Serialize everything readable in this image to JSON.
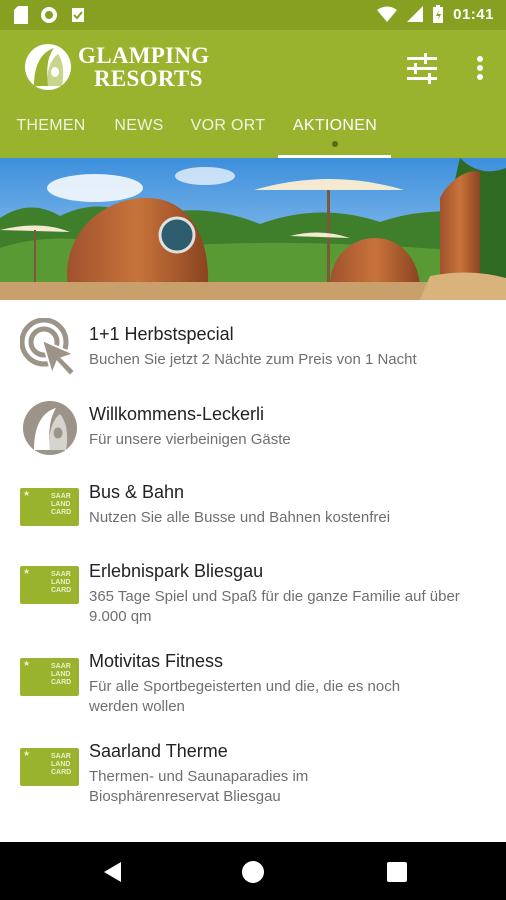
{
  "status_bar": {
    "time": "01:41",
    "left_icons": [
      "sd-card-icon",
      "circle-notification-icon",
      "download-done-icon"
    ],
    "right_icons": [
      "wifi-icon",
      "cellular-signal-icon",
      "battery-charging-icon"
    ]
  },
  "app_bar": {
    "logo_line1": "GLAMPING",
    "logo_line2": "RESORTS",
    "actions": [
      "tune-icon",
      "more-vert-icon"
    ],
    "color": "#9ab32e"
  },
  "tabs": [
    {
      "label": "THEMEN"
    },
    {
      "label": "NEWS"
    },
    {
      "label": "VOR ORT"
    },
    {
      "label": "AKTIONEN",
      "active": true
    }
  ],
  "card_text": [
    "SAAR",
    "LAND",
    "CARD"
  ],
  "items": [
    {
      "title": "1+1 Herbstspecial",
      "subtitle": "Buchen Sie jetzt 2 Nächte zum Preis von 1 Nacht",
      "icon": "click-cursor-icon"
    },
    {
      "title": "Willkommens-Leckerli",
      "subtitle": "Für unsere vierbeinigen Gäste",
      "icon": "resort-logo-icon"
    },
    {
      "title": "Bus & Bahn",
      "subtitle": "Nutzen Sie alle Busse und Bahnen kostenfrei",
      "icon": "saarland-card-icon"
    },
    {
      "title": "Erlebnispark Bliesgau",
      "subtitle": "365 Tage Spiel und Spaß für die ganze Familie auf über 9.000 qm",
      "icon": "saarland-card-icon"
    },
    {
      "title": "Motivitas Fitness",
      "subtitle": "Für alle Sportbegeisterten und die, die es noch werden wollen",
      "icon": "saarland-card-icon"
    },
    {
      "title": "Saarland Therme",
      "subtitle": "Thermen- und Saunaparadies im Biosphärenreservat Bliesgau",
      "icon": "saarland-card-icon"
    }
  ],
  "nav_bar": [
    "back-icon",
    "home-icon",
    "recents-icon"
  ]
}
